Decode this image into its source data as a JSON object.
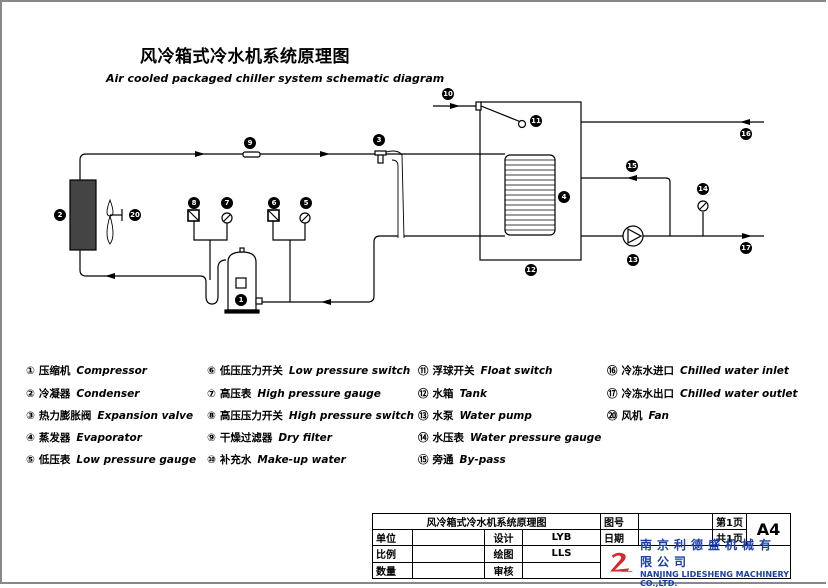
{
  "title": {
    "cn": "风冷箱式冷水机系统原理图",
    "en": "Air cooled packaged chiller system schematic diagram"
  },
  "callouts": {
    "c1": "1",
    "c2": "2",
    "c3": "3",
    "c4": "4",
    "c5": "5",
    "c6": "6",
    "c7": "7",
    "c8": "8",
    "c9": "9",
    "c10": "10",
    "c11": "11",
    "c12": "12",
    "c13": "13",
    "c14": "14",
    "c15": "15",
    "c16": "16",
    "c17": "17",
    "c20": "20"
  },
  "legend": {
    "col1": [
      {
        "num": "①",
        "cn": "压缩机",
        "en": "Compressor"
      },
      {
        "num": "②",
        "cn": "冷凝器",
        "en": "Condenser"
      },
      {
        "num": "③",
        "cn": "热力膨胀阀",
        "en": "Expansion valve"
      },
      {
        "num": "④",
        "cn": "蒸发器",
        "en": "Evaporator"
      },
      {
        "num": "⑤",
        "cn": "低压表",
        "en": "Low pressure gauge"
      }
    ],
    "col2": [
      {
        "num": "⑥",
        "cn": "低压压力开关",
        "en": "Low pressure switch"
      },
      {
        "num": "⑦",
        "cn": "高压表",
        "en": "High pressure gauge"
      },
      {
        "num": "⑧",
        "cn": "高压压力开关",
        "en": "High pressure switch"
      },
      {
        "num": "⑨",
        "cn": "干燥过滤器",
        "en": "Dry filter"
      },
      {
        "num": "⑩",
        "cn": "补充水",
        "en": "Make-up water"
      }
    ],
    "col3": [
      {
        "num": "⑪",
        "cn": "浮球开关",
        "en": "Float switch"
      },
      {
        "num": "⑫",
        "cn": "水箱",
        "en": "Tank"
      },
      {
        "num": "⑬",
        "cn": "水泵",
        "en": "Water pump"
      },
      {
        "num": "⑭",
        "cn": "水压表",
        "en": "Water pressure gauge"
      },
      {
        "num": "⑮",
        "cn": "旁通",
        "en": "By-pass"
      }
    ],
    "col4": [
      {
        "num": "⑯",
        "cn": "冷冻水进口",
        "en": "Chilled water inlet"
      },
      {
        "num": "⑰",
        "cn": "冷冻水出口",
        "en": "Chilled water outlet"
      },
      {
        "num": "⑳",
        "cn": "风机",
        "en": "Fan"
      }
    ]
  },
  "title_block": {
    "drawing_name": "风冷箱式冷水机系统原理图",
    "drawing_no_label": "图号",
    "drawing_no_value": "",
    "sheet": "第1页",
    "total_sheets": "共1页",
    "paper_size": "A4",
    "unit_label": "单位",
    "unit_value": "",
    "design_label": "设计",
    "design_value": "LYB",
    "date_label": "日期",
    "date_value": "",
    "scale_label": "比例",
    "scale_value": "",
    "drawn_label": "绘图",
    "drawn_value": "LLS",
    "quantity_label": "数量",
    "quantity_value": "",
    "review_label": "审核",
    "review_value": "",
    "company_cn": "南京利德盛机械有限公司",
    "company_en": "NANJING LIDESHENG MACHINERY CO.,LTD.",
    "logo_color": "#d8262c",
    "company_color": "#1a3fa8"
  }
}
